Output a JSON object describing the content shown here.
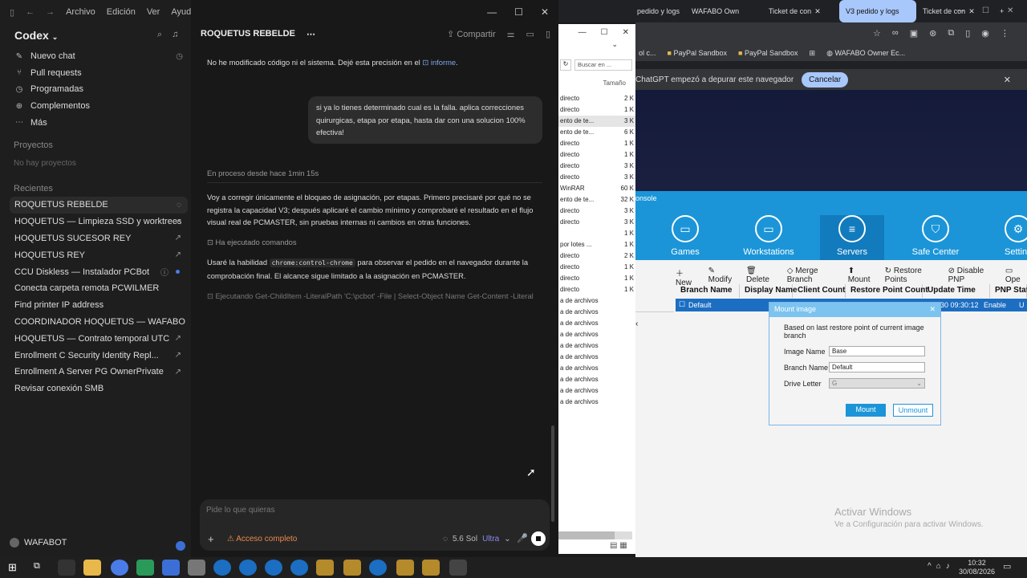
{
  "menubar": {
    "items": [
      "Archivo",
      "Edición",
      "Ver",
      "Ayuda"
    ]
  },
  "sidebar": {
    "brand": "Codex",
    "nav": [
      {
        "label": "Nuevo chat",
        "icon": "edit-icon"
      },
      {
        "label": "Pull requests",
        "icon": "pull-request-icon"
      },
      {
        "label": "Programadas",
        "icon": "clock-icon"
      },
      {
        "label": "Complementos",
        "icon": "plugin-icon"
      },
      {
        "label": "Más",
        "icon": "dots-icon"
      }
    ],
    "projects_title": "Proyectos",
    "projects_empty": "No hay proyectos",
    "recent_title": "Recientes",
    "recent": [
      "ROQUETUS REBELDE",
      "HOQUETUS — Limpieza SSD y worktrees",
      "HOQUETUS SUCESOR REY",
      "HOQUETUS REY",
      "CCU Diskless — Instalador PCBot acumul",
      "Conecta carpeta remota PCWILMER",
      "Find printer IP address",
      "COORDINADOR HOQUETUS — WAFABO",
      "HOQUETUS — Contrato temporal UTC",
      "Enrollment C Security Identity Repl...",
      "Enrollment A Server PG OwnerPrivate",
      "Revisar conexión SMB"
    ],
    "user": "WAFABOT"
  },
  "main": {
    "title": "ROQUETUS REBELDE",
    "share": "Compartir",
    "msg1_a": "No he modificado código ni el sistema. Dejé esta precisión en el",
    "msg1_link": "informe",
    "user_msg": "si ya lo tienes determinado cual es la falla. aplica correcciones quirurgicas, etapa por etapa, hasta dar con una solucion 100% efectiva!",
    "status": "En proceso desde hace 1min 15s",
    "msg2": "Voy a corregir únicamente el bloqueo de asignación, por etapas. Primero precisaré por qué no se registra la capacidad V3; después aplicaré el cambio mínimo y comprobaré el resultado en el flujo visual real de PCMASTER, sin pruebas internas ni cambios en otras funciones.",
    "exec_done": "Ha ejecutado comandos",
    "msg3_a": "Usaré la habilidad",
    "msg3_code": "chrome:control-chrome",
    "msg3_b": "para observar el pedido en el navegador durante la comprobación final. El alcance sigue limitado a la asignación en PCMASTER.",
    "exec_running": "Ejecutando Get-ChildItem -LiteralPath 'C:\\pcbot' -File | Select-Object Name Get-Content -Literal",
    "input_placeholder": "Pide lo que quieras",
    "access": "Acceso completo",
    "model": "5.6 Sol",
    "model_tier": "Ultra"
  },
  "explorer": {
    "search_placeholder": "Buscar en ...",
    "col_size": "Tamaño",
    "rows": [
      {
        "name": "directo",
        "size": "2 K"
      },
      {
        "name": "directo",
        "size": "1 K"
      },
      {
        "name": "ento de te...",
        "size": "3 K"
      },
      {
        "name": "ento de te...",
        "size": "6 K"
      },
      {
        "name": "directo",
        "size": "1 K"
      },
      {
        "name": "directo",
        "size": "1 K"
      },
      {
        "name": "directo",
        "size": "3 K"
      },
      {
        "name": "directo",
        "size": "3 K"
      },
      {
        "name": "WinRAR",
        "size": "60 K"
      },
      {
        "name": "ento de te...",
        "size": "32 K"
      },
      {
        "name": "directo",
        "size": "3 K"
      },
      {
        "name": "directo",
        "size": "3 K"
      },
      {
        "name": "",
        "size": "1 K"
      },
      {
        "name": "por lotes ...",
        "size": "1 K"
      },
      {
        "name": "directo",
        "size": "2 K"
      },
      {
        "name": "directo",
        "size": "1 K"
      },
      {
        "name": "directo",
        "size": "1 K"
      },
      {
        "name": "directo",
        "size": "1 K"
      },
      {
        "name": "a de archivos",
        "size": ""
      },
      {
        "name": "a de archivos",
        "size": ""
      },
      {
        "name": "a de archivos",
        "size": ""
      },
      {
        "name": "a de archivos",
        "size": ""
      },
      {
        "name": "a de archivos",
        "size": ""
      },
      {
        "name": "a de archivos",
        "size": ""
      },
      {
        "name": "a de archivos",
        "size": ""
      },
      {
        "name": "a de archivos",
        "size": ""
      },
      {
        "name": "a de archivos",
        "size": ""
      },
      {
        "name": "a de archivos",
        "size": ""
      }
    ]
  },
  "browser": {
    "tabs": [
      "pedido y logs",
      "WAFABO Own",
      "Ticket de con",
      "V3 pedido y logs",
      "Ticket de con"
    ],
    "bookmarks": [
      "ol c...",
      "PayPal Sandbox",
      "PayPal Sandbox",
      "WAFABO Owner Ec..."
    ],
    "debug_text": "ChatGPT empezó a depurar este navegador",
    "cancel": "Cancelar",
    "console_label": "onsole",
    "nav": [
      "Games",
      "Workstations",
      "Servers",
      "Safe Center",
      "Settin"
    ],
    "tools": [
      "New",
      "Modify",
      "Delete",
      "Merge Branch",
      "Mount",
      "Restore Points",
      "Disable PNP",
      "Ope"
    ],
    "columns": [
      "Branch Name",
      "Display Name",
      "Client Count",
      "Restore Point Count",
      "Update Time",
      "PNP State",
      "Bo"
    ],
    "row": {
      "branch": "Default",
      "time": "30 09:30:12",
      "pnp": "Enable",
      "bo": "U"
    },
    "dialog": {
      "title": "Mount image",
      "desc": "Based on last restore point of current image branch",
      "image_label": "Image Name",
      "image_value": "Base",
      "branch_label": "Branch Name",
      "branch_value": "Default",
      "drive_label": "Drive Letter",
      "drive_value": "G",
      "mount": "Mount",
      "unmount": "Unmount"
    },
    "watermark_title": "Activar Windows",
    "watermark_sub": "Ve a Configuración para activar Windows."
  },
  "taskbar": {
    "time": "10:32",
    "date": "30/08/2026"
  }
}
